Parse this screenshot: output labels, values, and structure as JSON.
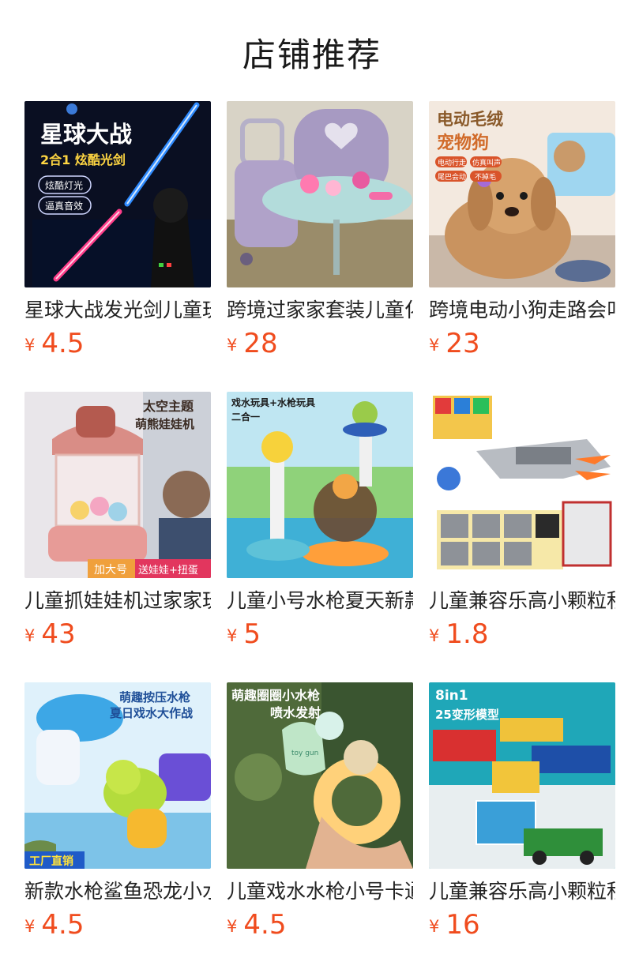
{
  "title": "店铺推荐",
  "colors": {
    "price": "#f04c1e",
    "title": "#1a1a1a"
  },
  "products": [
    {
      "name": "星球大战发光剑儿童玩具",
      "currency": "¥",
      "price": "4.5",
      "image": {
        "text_lines": [
          "星球大战",
          "2合1 炫酷光剑",
          "炫酷灯光",
          "逼真音效"
        ]
      }
    },
    {
      "name": "跨境过家家套装儿童化妆箱",
      "currency": "¥",
      "price": "28",
      "image": {
        "text_lines": []
      }
    },
    {
      "name": "跨境电动小狗走路会叫",
      "currency": "¥",
      "price": "23",
      "image": {
        "text_lines": [
          "电动毛绒",
          "宠物狗",
          "电动行走",
          "仿真叫声",
          "尾巴会动",
          "不掉毛"
        ]
      }
    },
    {
      "name": "儿童抓娃娃机过家家玩具",
      "currency": "¥",
      "price": "43",
      "image": {
        "text_lines": [
          "太空主题",
          "萌熊娃娃机",
          "加大号",
          "送娃娃+扭蛋"
        ]
      }
    },
    {
      "name": "儿童小号水枪夏天新款玩具",
      "currency": "¥",
      "price": "5",
      "image": {
        "text_lines": [
          "戏水玩具+水枪玩具",
          "二合一"
        ]
      }
    },
    {
      "name": "儿童兼容乐高小颗粒积木",
      "currency": "¥",
      "price": "1.8",
      "image": {
        "text_lines": []
      }
    },
    {
      "name": "新款水枪鲨鱼恐龙小水枪",
      "currency": "¥",
      "price": "4.5",
      "image": {
        "text_lines": [
          "萌趣按压水枪",
          "夏日戏水大作战",
          "工厂直销"
        ]
      }
    },
    {
      "name": "儿童戏水水枪小号卡通",
      "currency": "¥",
      "price": "4.5",
      "image": {
        "text_lines": [
          "萌趣圈圈小水枪",
          "喷水发射",
          "toy gun"
        ]
      }
    },
    {
      "name": "儿童兼容乐高小颗粒积木",
      "currency": "¥",
      "price": "16",
      "image": {
        "text_lines": [
          "8in1",
          "25变形模型"
        ]
      }
    }
  ]
}
